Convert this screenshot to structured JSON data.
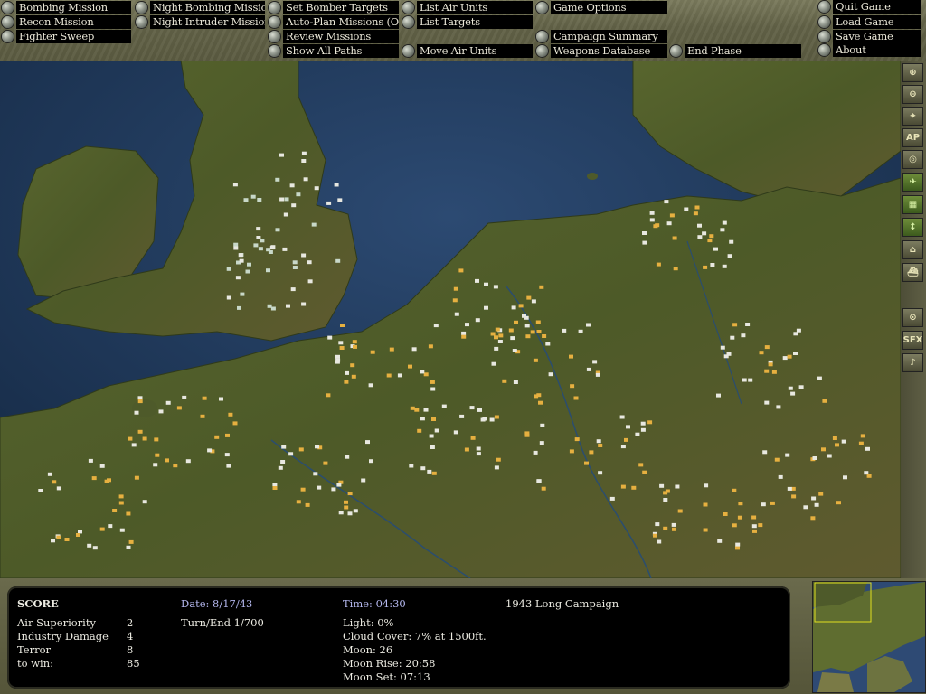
{
  "menu": {
    "col1": [
      "Bombing Mission",
      "Recon Mission",
      "Fighter Sweep"
    ],
    "col2": [
      "Night Bombing Mission",
      "Night Intruder Mission"
    ],
    "col3": [
      "Set Bomber Targets",
      "Auto-Plan Missions (Off)",
      "Review Missions",
      "Show All Paths"
    ],
    "col4": [
      "List Air Units",
      "List Targets"
    ],
    "move_air_units": "Move Air Units",
    "col5": [
      "Game Options",
      "Campaign Summary",
      "Weapons Database"
    ],
    "end_phase": "End Phase",
    "col6": [
      "Quit Game",
      "Load Game",
      "Save Game",
      "About"
    ]
  },
  "toolbar": {
    "icons": [
      "zoom-in-icon",
      "zoom-out-icon",
      "center-icon",
      "ap-icon",
      "target-icon",
      "air-unit-icon",
      "airfield-icon",
      "move-arrow-icon",
      "building-icon",
      "ship-icon",
      "radar-icon",
      "sfx-icon",
      "music-icon"
    ],
    "ap_label": "AP",
    "sfx_label": "SFX",
    "zoom_in_glyph": "⊕",
    "zoom_out_glyph": "⊖",
    "center_glyph": "⌖",
    "target_glyph": "◎",
    "air_glyph": "✈",
    "airfield_glyph": "▦",
    "move_glyph": "↕",
    "building_glyph": "⌂",
    "ship_glyph": "⛴",
    "radar_glyph": "⊙",
    "music_glyph": "♪"
  },
  "status": {
    "score_heading": "SCORE",
    "rows": [
      {
        "label": "Air Superiority",
        "value": "2"
      },
      {
        "label": "Industry Damage",
        "value": "4"
      },
      {
        "label": "Terror",
        "value": "8"
      },
      {
        "label": "to win:",
        "value": "85"
      }
    ],
    "date": "Date: 8/17/43",
    "turn": "Turn/End 1/700",
    "time": "Time: 04:30",
    "light": "Light: 0%",
    "cloud": "Cloud Cover: 7% at 1500ft.",
    "moon": "Moon: 26",
    "moon_rise": "Moon Rise: 20:58",
    "moon_set": "Moon Set: 07:13",
    "campaign": "1943 Long Campaign"
  },
  "colors": {
    "sea": "#1d3556",
    "land": "#4e5a2a",
    "menu_bg": "#000000",
    "menu_text": "#eae7d8",
    "date_blue": "#b4b7ee"
  }
}
